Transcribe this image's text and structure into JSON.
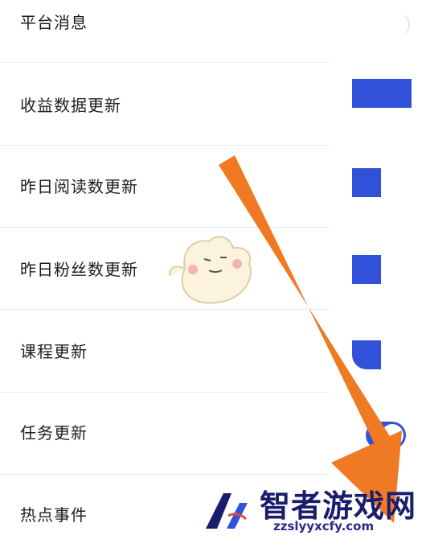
{
  "settings": {
    "items": [
      {
        "label": "平台消息",
        "toggle": "off"
      },
      {
        "label": "收益数据更新",
        "toggle": "on"
      },
      {
        "label": "昨日阅读数更新",
        "toggle": "on"
      },
      {
        "label": "昨日粉丝数更新",
        "toggle": "on"
      },
      {
        "label": "课程更新",
        "toggle": "on"
      },
      {
        "label": "任务更新",
        "toggle": "on"
      },
      {
        "label": "热点事件",
        "toggle": "on"
      }
    ]
  },
  "colors": {
    "toggle_on": "#3152d8",
    "arrow": "#f07a23",
    "watermark": "#1a1d6e"
  },
  "overlay": {
    "arrow_icon": "arrow-down-right-icon",
    "mascot_icon": "mascot-sticker-icon"
  },
  "watermark": {
    "brand": "智者游戏网",
    "url": "zzslyyxcfy.com"
  }
}
